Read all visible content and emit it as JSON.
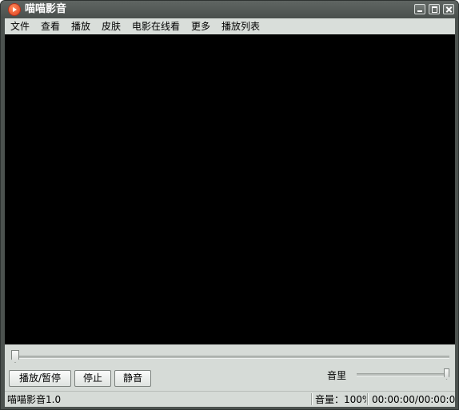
{
  "window": {
    "title": "喵喵影音",
    "icon": "play-circle-icon",
    "controls": [
      "minimize-icon",
      "maximize-icon",
      "close-icon"
    ]
  },
  "menu": {
    "items": [
      "文件",
      "查看",
      "播放",
      "皮肤",
      "电影在线看",
      "更多",
      "播放列表"
    ]
  },
  "controls": {
    "play_pause_label": "播放/暂停",
    "stop_label": "停止",
    "mute_label": "静音",
    "volume_label": "音里",
    "seek_progress": 0,
    "volume_level": 1.0
  },
  "status": {
    "app_version": "喵喵影音1.0",
    "volume_text": "音量：100%",
    "time_text": "00:00:00/00:00:00"
  },
  "colors": {
    "titlebar": "#4c524f",
    "panel": "#d6dbd7",
    "video_bg": "#000000",
    "accent_icon": "#e0401e"
  }
}
